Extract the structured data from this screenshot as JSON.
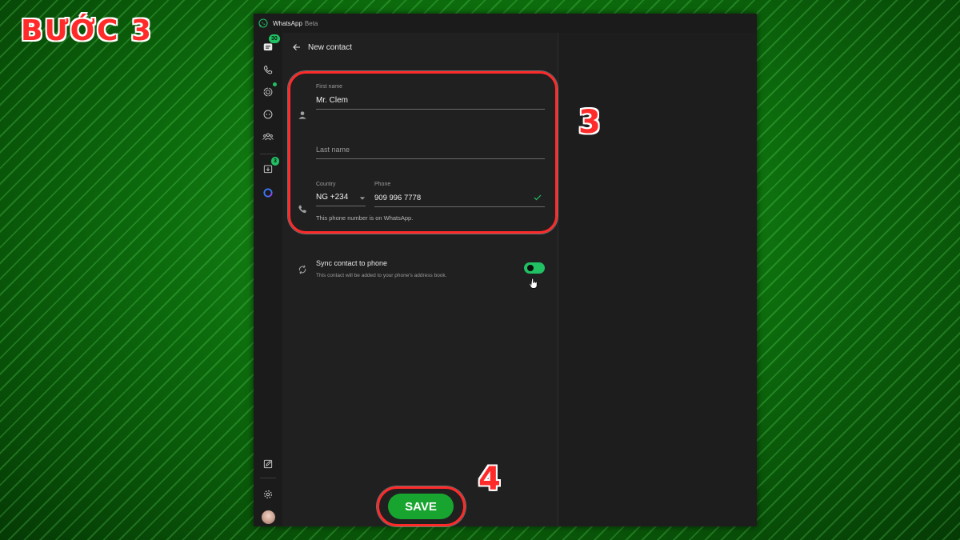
{
  "overlay": {
    "step_title": "BƯỚC 3",
    "marker_form": "3",
    "marker_save": "4"
  },
  "window": {
    "app_name": "WhatsApp",
    "app_suffix": "Beta"
  },
  "rail": {
    "chats_badge": "30",
    "archive_badge": "3"
  },
  "form": {
    "header_title": "New contact",
    "first_name_label": "First name",
    "first_name_value": "Mr. Clem",
    "last_name_placeholder": "Last name",
    "country_label": "Country",
    "country_value": "NG +234",
    "phone_label": "Phone",
    "phone_value": "909 996 7778",
    "phone_hint": "This phone number is on WhatsApp.",
    "sync_title": "Sync contact to phone",
    "sync_subtitle": "This contact will be added to your phone's address book.",
    "sync_enabled": true,
    "save_label": "SAVE"
  },
  "colors": {
    "accent": "#21c063",
    "annotation": "#ff2a2a",
    "save_button": "#18a52f"
  }
}
